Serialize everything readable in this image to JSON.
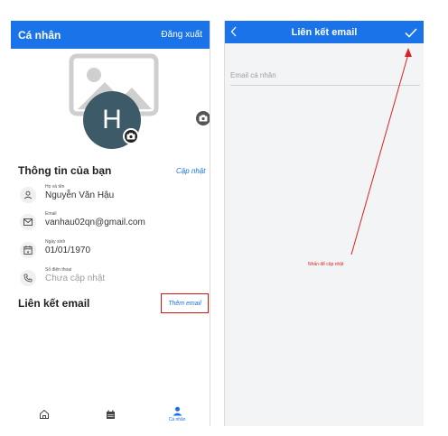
{
  "left_screen": {
    "header": {
      "title": "Cá nhân",
      "logout_label": "Đăng xuất"
    },
    "avatar": {
      "initial": "H"
    },
    "info_section": {
      "title": "Thông tin của bạn",
      "update_link": "Cập nhật",
      "rows": [
        {
          "label": "Họ và tên",
          "value": "Nguyễn Văn Hậu",
          "icon": "person-icon"
        },
        {
          "label": "Email",
          "value": "vanhau02qn@gmail.com",
          "icon": "mail-icon"
        },
        {
          "label": "Ngày sinh",
          "value": "01/01/1970",
          "icon": "calendar-icon"
        },
        {
          "label": "Số điện thoại",
          "value": "Chưa cập nhật",
          "icon": "phone-icon"
        }
      ]
    },
    "email_link_section": {
      "title": "Liên kết email",
      "add_link": "Thêm email"
    },
    "bottom_nav": {
      "active_label": "Cá nhân"
    }
  },
  "right_screen": {
    "header": {
      "title": "Liên kết email"
    },
    "email_input": {
      "placeholder": "Email cá nhân",
      "value": ""
    }
  },
  "annotation": {
    "text": "Nhấn để cập nhật",
    "color": "#e02020"
  },
  "colors": {
    "brand_blue": "#1a73e8",
    "highlight_red": "#dd1111",
    "avatar_bg": "#3d5a68"
  }
}
